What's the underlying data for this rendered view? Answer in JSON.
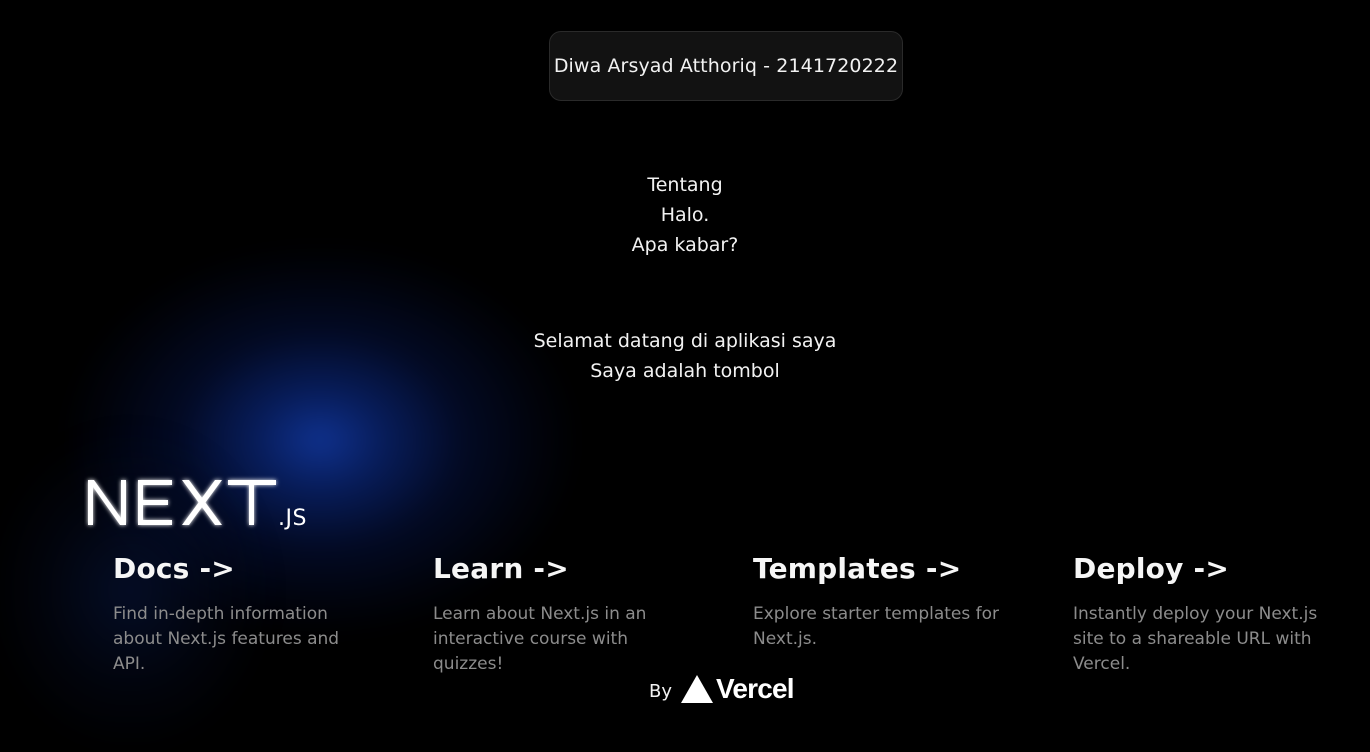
{
  "header": {
    "student_label": "Diwa Arsyad Atthoriq - 2141720222"
  },
  "intro": {
    "lines": [
      "Tentang",
      "Halo.",
      "Apa kabar?"
    ]
  },
  "welcome": {
    "lines": [
      "Selamat datang di aplikasi saya",
      "Saya adalah tombol"
    ]
  },
  "logo": {
    "main": "NEXT",
    "suffix": ".JS"
  },
  "cards": [
    {
      "title": "Docs ->",
      "description": "Find in-depth information about Next.js features and API."
    },
    {
      "title": "Learn ->",
      "description": "Learn about Next.js in an interactive course with quizzes!"
    },
    {
      "title": "Templates ->",
      "description": "Explore starter templates for Next.js."
    },
    {
      "title": "Deploy ->",
      "description": "Instantly deploy your Next.js site to a shareable URL with Vercel."
    }
  ],
  "footer": {
    "by_label": "By",
    "brand": "Vercel"
  },
  "colors": {
    "background": "#000000",
    "glow": "#0b2a86",
    "card_title": "#f6f6f6",
    "card_text": "#8c8c8c",
    "pill_bg": "#121212",
    "pill_border": "#2a2a2a"
  }
}
